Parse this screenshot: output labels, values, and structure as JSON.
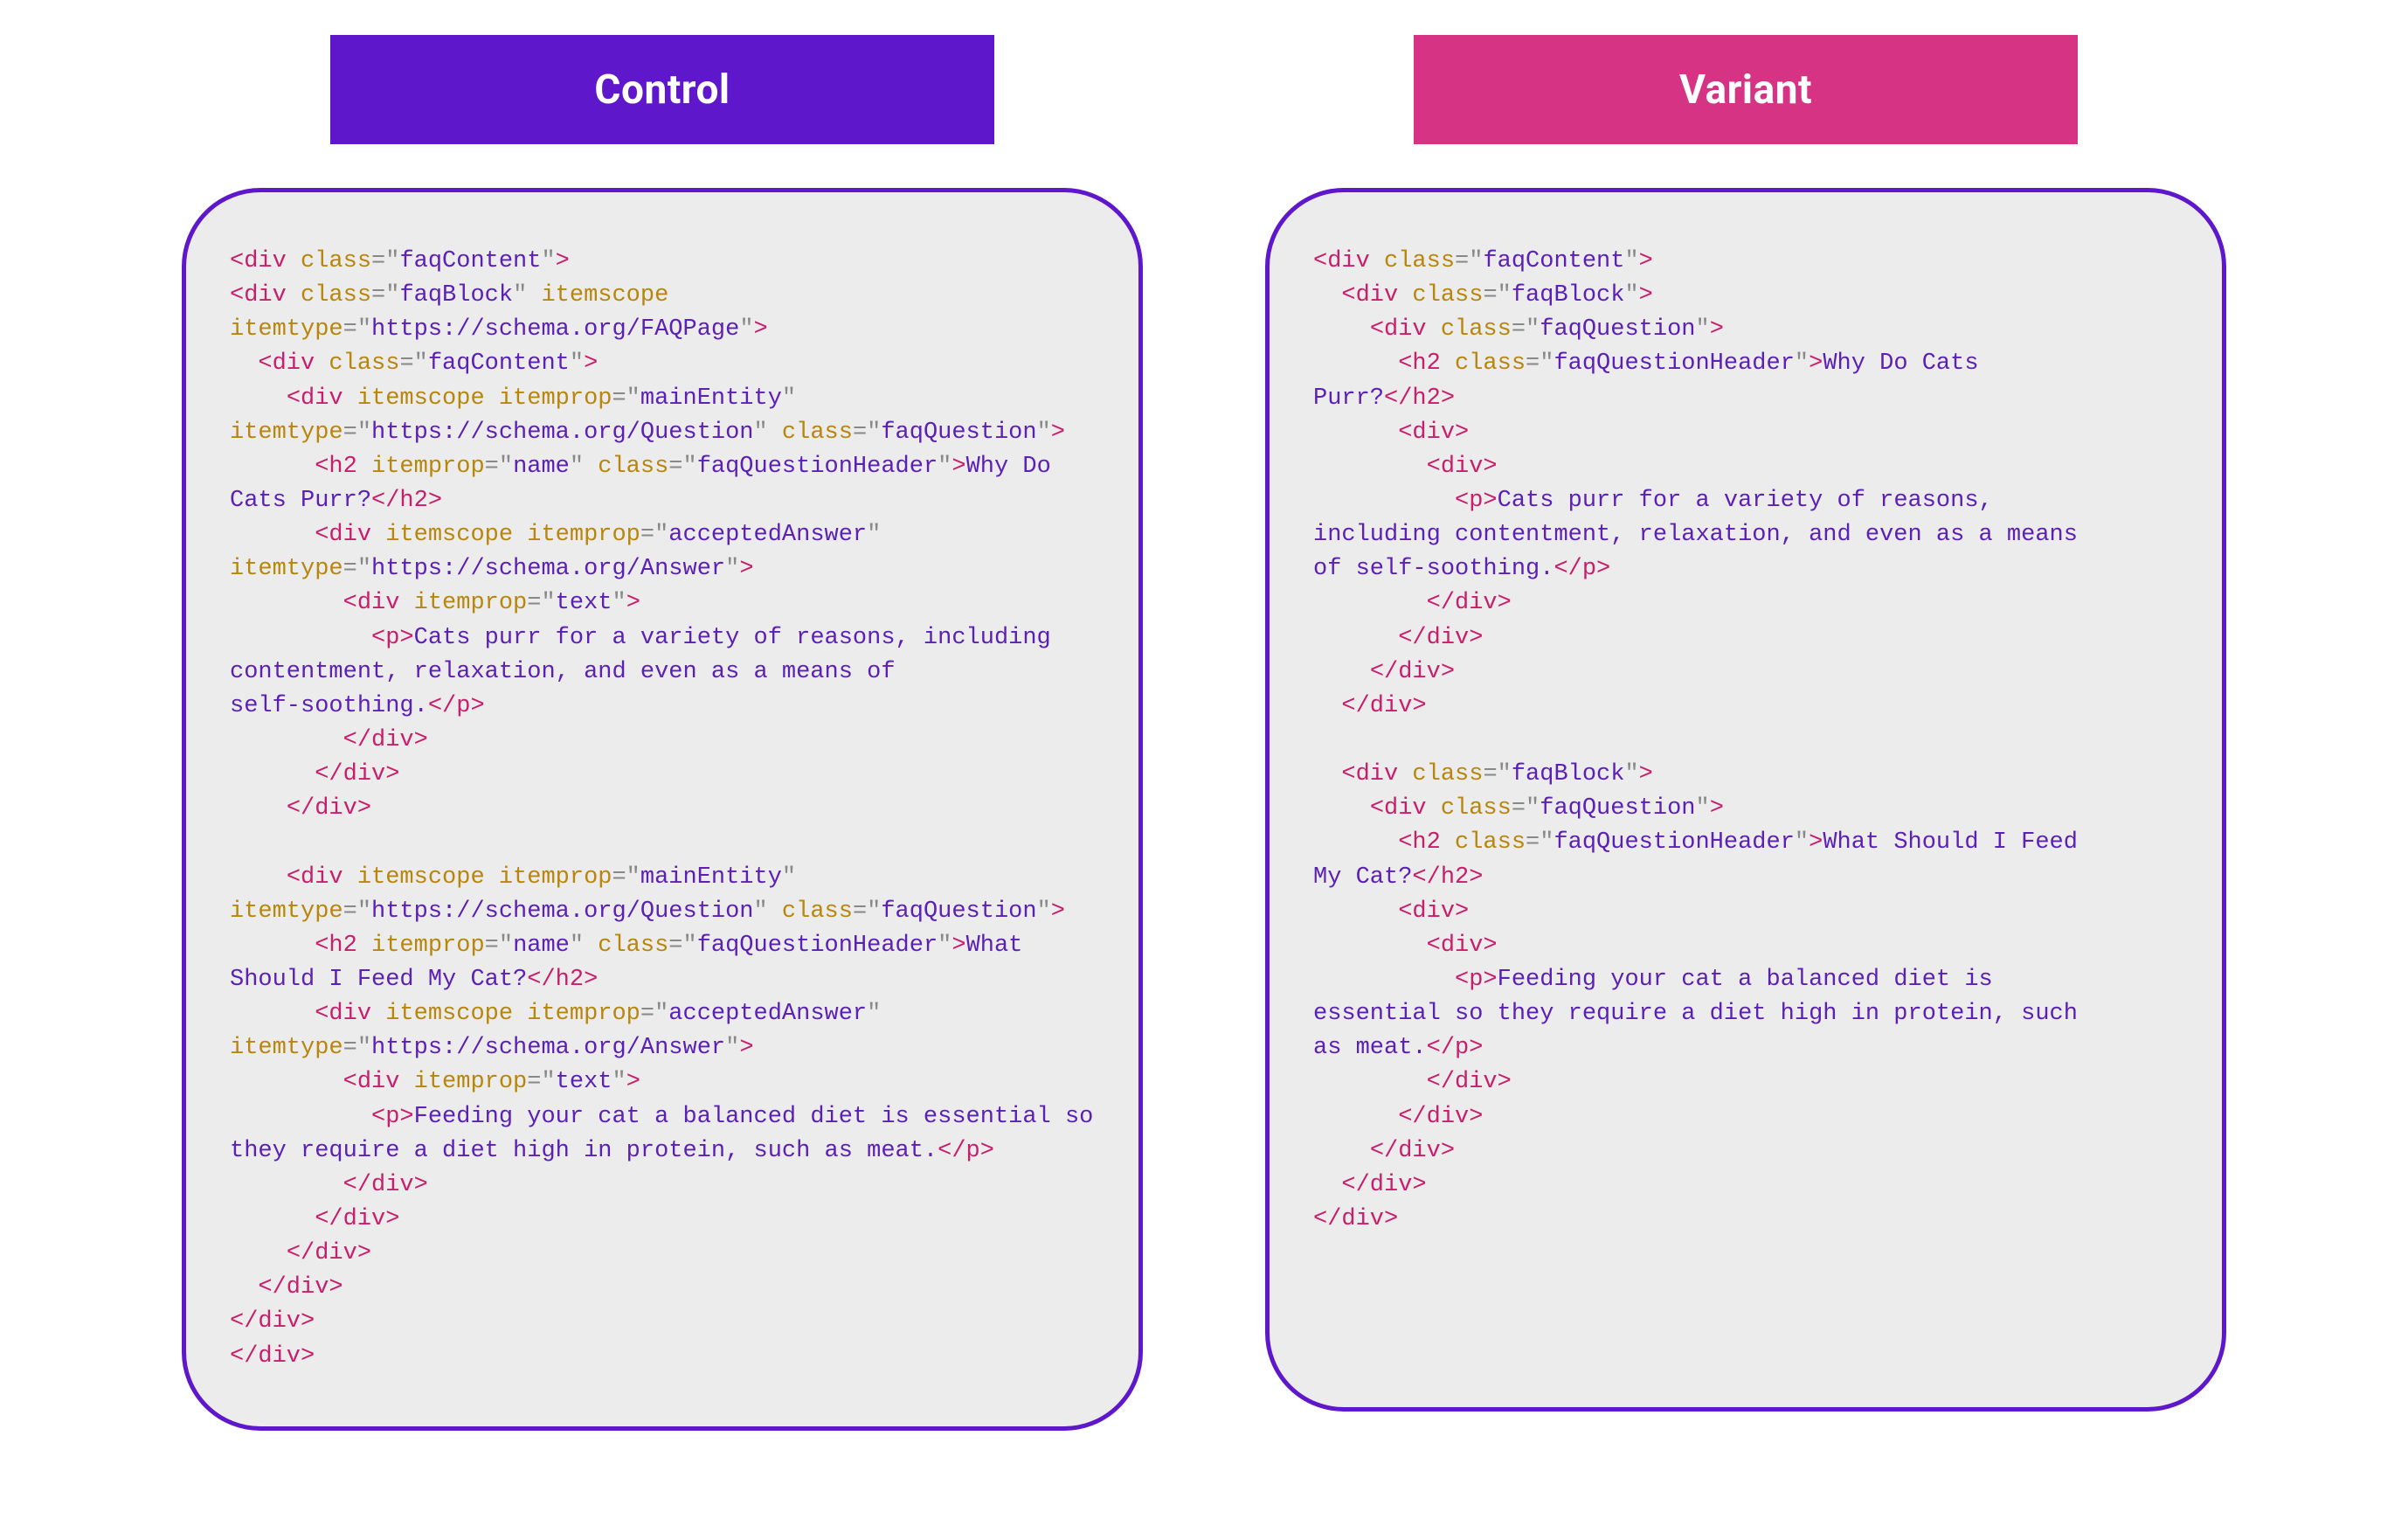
{
  "colors": {
    "purple": "#5E17CB",
    "pink": "#D63384",
    "code_bg": "#ECECEC",
    "tag_pink": "#C71F6B",
    "attr_gold": "#B8860B",
    "value_purple": "#5B21B6",
    "punct_gray": "#888888"
  },
  "control": {
    "label": "Control",
    "code": [
      {
        "i": 0,
        "k": [
          "t:<div",
          " ",
          "a:class",
          "p:=\"",
          "v:faqContent",
          "p:\"",
          "t:>"
        ]
      },
      {
        "i": 0,
        "k": [
          "t:<div",
          " ",
          "a:class",
          "p:=\"",
          "v:faqBlock",
          "p:\"",
          " ",
          "a:itemscope"
        ]
      },
      {
        "i": 0,
        "k": [
          "a:itemtype",
          "p:=\"",
          "v:https://schema.org/FAQPage",
          "p:\"",
          "t:>"
        ]
      },
      {
        "i": 1,
        "k": [
          "t:<div",
          " ",
          "a:class",
          "p:=\"",
          "v:faqContent",
          "p:\"",
          "t:>"
        ]
      },
      {
        "i": 2,
        "k": [
          "t:<div",
          " ",
          "a:itemscope",
          " ",
          "a:itemprop",
          "p:=\"",
          "v:mainEntity",
          "p:\""
        ]
      },
      {
        "i": 0,
        "k": [
          "a:itemtype",
          "p:=\"",
          "v:https://schema.org/Question",
          "p:\"",
          " ",
          "a:class",
          "p:=\"",
          "v:faqQuestion",
          "p:\"",
          "t:>"
        ]
      },
      {
        "i": 3,
        "k": [
          "t:<h2",
          " ",
          "a:itemprop",
          "p:=\"",
          "v:name",
          "p:\"",
          " ",
          "a:class",
          "p:=\"",
          "v:faqQuestionHeader",
          "p:\"",
          "t:>",
          "tx:Why Do"
        ]
      },
      {
        "i": 0,
        "k": [
          "tx:Cats Purr?",
          "t:</h2>"
        ]
      },
      {
        "i": 3,
        "k": [
          "t:<div",
          " ",
          "a:itemscope",
          " ",
          "a:itemprop",
          "p:=\"",
          "v:acceptedAnswer",
          "p:\""
        ]
      },
      {
        "i": 0,
        "k": [
          "a:itemtype",
          "p:=\"",
          "v:https://schema.org/Answer",
          "p:\"",
          "t:>"
        ]
      },
      {
        "i": 4,
        "k": [
          "t:<div",
          " ",
          "a:itemprop",
          "p:=\"",
          "v:text",
          "p:\"",
          "t:>"
        ]
      },
      {
        "i": 5,
        "k": [
          "t:<p>",
          "tx:Cats purr for a variety of reasons, including"
        ]
      },
      {
        "i": 0,
        "k": [
          "tx:contentment, relaxation, and even as a means of"
        ]
      },
      {
        "i": 0,
        "k": [
          "tx:self-soothing.",
          "t:</p>"
        ]
      },
      {
        "i": 4,
        "k": [
          "t:</div>"
        ]
      },
      {
        "i": 3,
        "k": [
          "t:</div>"
        ]
      },
      {
        "i": 2,
        "k": [
          "t:</div>"
        ]
      },
      {
        "i": 0,
        "k": []
      },
      {
        "i": 2,
        "k": [
          "t:<div",
          " ",
          "a:itemscope",
          " ",
          "a:itemprop",
          "p:=\"",
          "v:mainEntity",
          "p:\""
        ]
      },
      {
        "i": 0,
        "k": [
          "a:itemtype",
          "p:=\"",
          "v:https://schema.org/Question",
          "p:\"",
          " ",
          "a:class",
          "p:=\"",
          "v:faqQuestion",
          "p:\"",
          "t:>"
        ]
      },
      {
        "i": 3,
        "k": [
          "t:<h2",
          " ",
          "a:itemprop",
          "p:=\"",
          "v:name",
          "p:\"",
          " ",
          "a:class",
          "p:=\"",
          "v:faqQuestionHeader",
          "p:\"",
          "t:>",
          "tx:What"
        ]
      },
      {
        "i": 0,
        "k": [
          "tx:Should I Feed My Cat?",
          "t:</h2>"
        ]
      },
      {
        "i": 3,
        "k": [
          "t:<div",
          " ",
          "a:itemscope",
          " ",
          "a:itemprop",
          "p:=\"",
          "v:acceptedAnswer",
          "p:\""
        ]
      },
      {
        "i": 0,
        "k": [
          "a:itemtype",
          "p:=\"",
          "v:https://schema.org/Answer",
          "p:\"",
          "t:>"
        ]
      },
      {
        "i": 4,
        "k": [
          "t:<div",
          " ",
          "a:itemprop",
          "p:=\"",
          "v:text",
          "p:\"",
          "t:>"
        ]
      },
      {
        "i": 5,
        "k": [
          "t:<p>",
          "tx:Feeding your cat a balanced diet is essential so"
        ]
      },
      {
        "i": 0,
        "k": [
          "tx:they require a diet high in protein, such as meat.",
          "t:</p>"
        ]
      },
      {
        "i": 4,
        "k": [
          "t:</div>"
        ]
      },
      {
        "i": 3,
        "k": [
          "t:</div>"
        ]
      },
      {
        "i": 2,
        "k": [
          "t:</div>"
        ]
      },
      {
        "i": 1,
        "k": [
          "t:</div>"
        ]
      },
      {
        "i": 0,
        "k": [
          "t:</div>"
        ]
      },
      {
        "i": 0,
        "k": [
          "t:</div>"
        ]
      }
    ]
  },
  "variant": {
    "label": "Variant",
    "code": [
      {
        "i": 0,
        "k": [
          "t:<div",
          " ",
          "a:class",
          "p:=\"",
          "v:faqContent",
          "p:\"",
          "t:>"
        ]
      },
      {
        "i": 1,
        "k": [
          "t:<div",
          " ",
          "a:class",
          "p:=\"",
          "v:faqBlock",
          "p:\"",
          "t:>"
        ]
      },
      {
        "i": 2,
        "k": [
          "t:<div",
          " ",
          "a:class",
          "p:=\"",
          "v:faqQuestion",
          "p:\"",
          "t:>"
        ]
      },
      {
        "i": 3,
        "k": [
          "t:<h2",
          " ",
          "a:class",
          "p:=\"",
          "v:faqQuestionHeader",
          "p:\"",
          "t:>",
          "tx:Why Do Cats"
        ]
      },
      {
        "i": 0,
        "k": [
          "tx:Purr?",
          "t:</h2>"
        ]
      },
      {
        "i": 3,
        "k": [
          "t:<div>"
        ]
      },
      {
        "i": 4,
        "k": [
          "t:<div>"
        ]
      },
      {
        "i": 5,
        "k": [
          "t:<p>",
          "tx:Cats purr for a variety of reasons,"
        ]
      },
      {
        "i": 0,
        "k": [
          "tx:including contentment, relaxation, and even as a means"
        ]
      },
      {
        "i": 0,
        "k": [
          "tx:of self-soothing.",
          "t:</p>"
        ]
      },
      {
        "i": 4,
        "k": [
          "t:</div>"
        ]
      },
      {
        "i": 3,
        "k": [
          "t:</div>"
        ]
      },
      {
        "i": 2,
        "k": [
          "t:</div>"
        ]
      },
      {
        "i": 1,
        "k": [
          "t:</div>"
        ]
      },
      {
        "i": 0,
        "k": []
      },
      {
        "i": 1,
        "k": [
          "t:<div",
          " ",
          "a:class",
          "p:=\"",
          "v:faqBlock",
          "p:\"",
          "t:>"
        ]
      },
      {
        "i": 2,
        "k": [
          "t:<div",
          " ",
          "a:class",
          "p:=\"",
          "v:faqQuestion",
          "p:\"",
          "t:>"
        ]
      },
      {
        "i": 3,
        "k": [
          "t:<h2",
          " ",
          "a:class",
          "p:=\"",
          "v:faqQuestionHeader",
          "p:\"",
          "t:>",
          "tx:What Should I Feed"
        ]
      },
      {
        "i": 0,
        "k": [
          "tx:My Cat?",
          "t:</h2>"
        ]
      },
      {
        "i": 3,
        "k": [
          "t:<div>"
        ]
      },
      {
        "i": 4,
        "k": [
          "t:<div>"
        ]
      },
      {
        "i": 5,
        "k": [
          "t:<p>",
          "tx:Feeding your cat a balanced diet is"
        ]
      },
      {
        "i": 0,
        "k": [
          "tx:essential so they require a diet high in protein, such"
        ]
      },
      {
        "i": 0,
        "k": [
          "tx:as meat.",
          "t:</p>"
        ]
      },
      {
        "i": 4,
        "k": [
          "t:</div>"
        ]
      },
      {
        "i": 3,
        "k": [
          "t:</div>"
        ]
      },
      {
        "i": 2,
        "k": [
          "t:</div>"
        ]
      },
      {
        "i": 1,
        "k": [
          "t:</div>"
        ]
      },
      {
        "i": 0,
        "k": [
          "t:</div>"
        ]
      }
    ]
  }
}
